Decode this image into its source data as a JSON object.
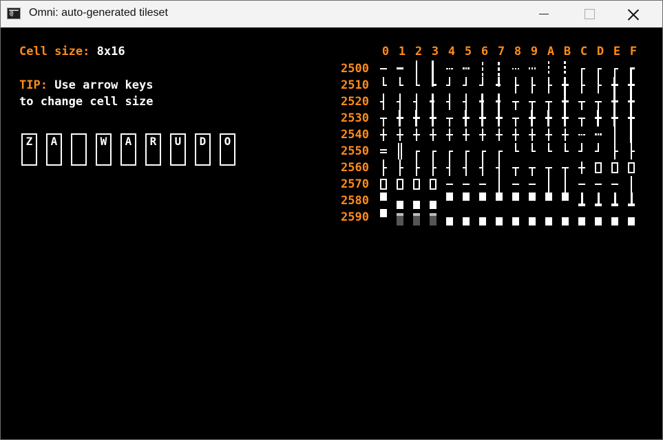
{
  "window": {
    "title": "Omni: auto-generated tileset",
    "icon": "terminal-icon"
  },
  "controls": {
    "minimize": "minimize-icon",
    "maximize": "maximize-icon",
    "close": "close-icon"
  },
  "colors": {
    "accent": "#ff8c1a",
    "text": "#ffffff",
    "background": "#000000"
  },
  "info": {
    "cell_label": "Cell size:",
    "cell_value": "8x16",
    "tip_label": "TIP:",
    "tip_text": "Use arrow keys",
    "tip_text2": "to change cell size"
  },
  "letters": [
    "Z",
    "A",
    "",
    "W",
    "A",
    "R",
    "U",
    "D",
    "O"
  ],
  "tileset": {
    "columns": [
      "0",
      "1",
      "2",
      "3",
      "4",
      "5",
      "6",
      "7",
      "8",
      "9",
      "A",
      "B",
      "C",
      "D",
      "E",
      "F"
    ],
    "rows": [
      "2500",
      "2510",
      "2520",
      "2530",
      "2540",
      "2550",
      "2560",
      "2570",
      "2580",
      "2590"
    ]
  }
}
